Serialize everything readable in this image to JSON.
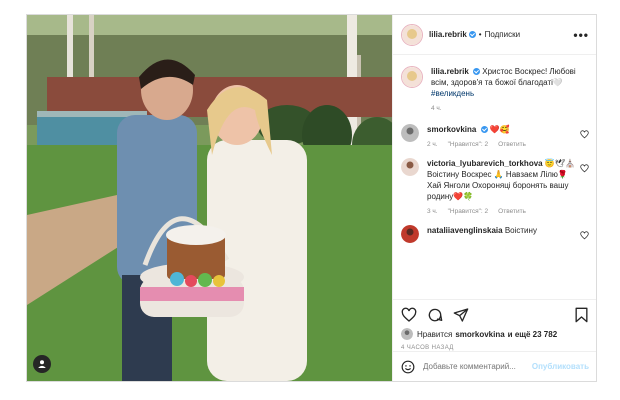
{
  "post": {
    "username": "lilia.rebrik",
    "follow_label": "Подписки",
    "caption_text": "Христос Воскрес! Любові всім, здоров'я та божої благодаті🤍",
    "caption_hashtag": "#великдень",
    "caption_time": "4 ч."
  },
  "comments": [
    {
      "username": "smorkovkina",
      "text": "❤️🥰",
      "time": "2 ч.",
      "likes": "\"Нравится\": 2",
      "reply": "Ответить"
    },
    {
      "username": "victoria_lyubarevich_torkhova",
      "text": "😇🕊⛪ Воістину Воскрес 🙏 Навзаєм Лілю🌹 Хай Янголи Охороняці боронять вашу родину❤️🍀",
      "time": "3 ч.",
      "likes": "\"Нравится\": 2",
      "reply": "Ответить"
    },
    {
      "username": "nataliiavenglinskaia",
      "text": "Воістину",
      "time": "",
      "likes": "",
      "reply": ""
    }
  ],
  "likes": {
    "prefix": "Нравится",
    "user": "smorkovkina",
    "suffix": "и ещё 23 782"
  },
  "time_ago": "4 ЧАСОВ НАЗАД",
  "add_comment": {
    "placeholder": "Добавьте комментарий...",
    "publish_label": "Опубликовать"
  },
  "icons": {
    "heart": "heart-icon",
    "comment": "comment-icon",
    "share": "share-icon",
    "save": "bookmark-icon",
    "more": "more-icon",
    "emoji": "emoji-icon",
    "user_tag": "user-tag-icon"
  },
  "colors": {
    "verified": "#3897f0",
    "link": "#00376b",
    "muted": "#8e8e8e",
    "publish_disabled": "#b2dffc"
  }
}
